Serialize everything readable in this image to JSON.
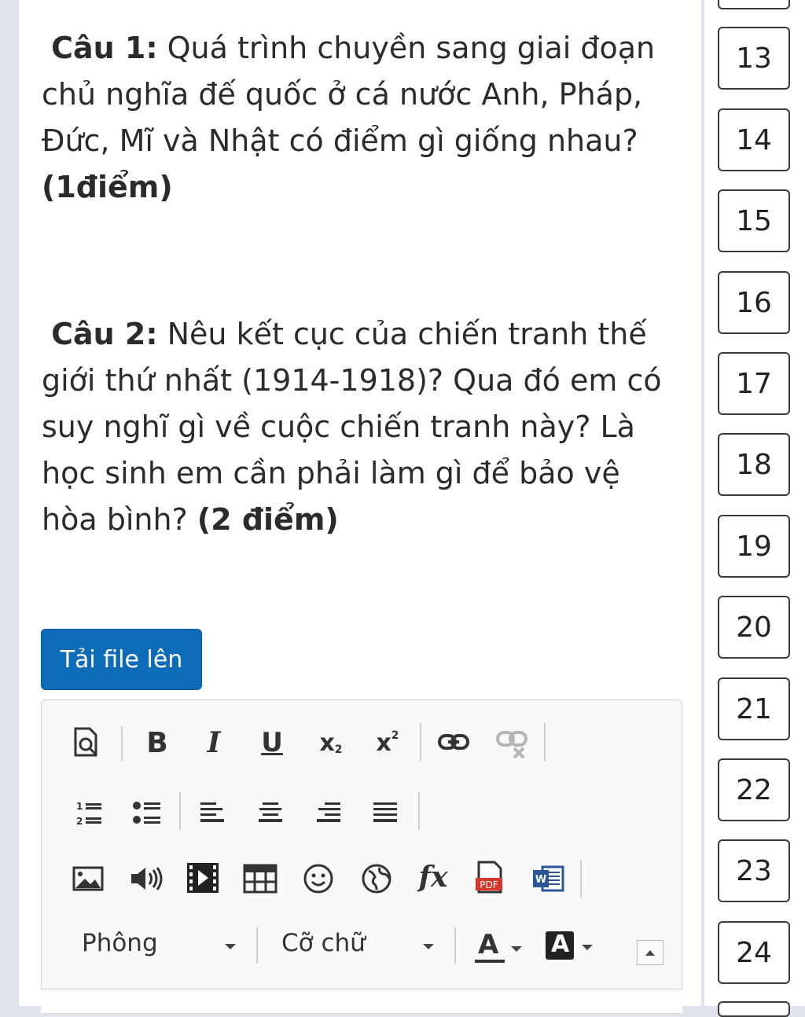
{
  "questions": [
    {
      "label": "Câu 1:",
      "text": " Quá trình chuyền sang giai đoạn chủ nghĩa đế quốc ở cá nước Anh, Pháp, Đức, Mĩ và Nhật có điểm gì giống nhau? ",
      "points": "(1điểm)"
    },
    {
      "label": "Câu 2:",
      "text": " Nêu kết cục của chiến tranh thế giới thứ nhất (1914-1918)? Qua đó em có suy nghĩ gì về cuộc chiến tranh này? Là học sinh em cần phải làm gì để bảo vệ hòa bình? ",
      "points": "(2 điểm)"
    }
  ],
  "upload_button": "Tải file lên",
  "editor": {
    "font_label": "Phông",
    "size_label": "Cỡ chữ",
    "bold": "B",
    "italic": "I",
    "underline": "U",
    "subscript": "x",
    "subscript_mark": "2",
    "superscript": "x",
    "superscript_mark": "2",
    "formula": "fx",
    "pdf": "PDF",
    "word": "W",
    "font_color": "A",
    "bg_color": "A"
  },
  "question_numbers": [
    "13",
    "14",
    "15",
    "16",
    "17",
    "18",
    "19",
    "20",
    "21",
    "22",
    "23",
    "24"
  ],
  "colors": {
    "accent": "#0e6bb8",
    "background": "#e2e4eb"
  }
}
